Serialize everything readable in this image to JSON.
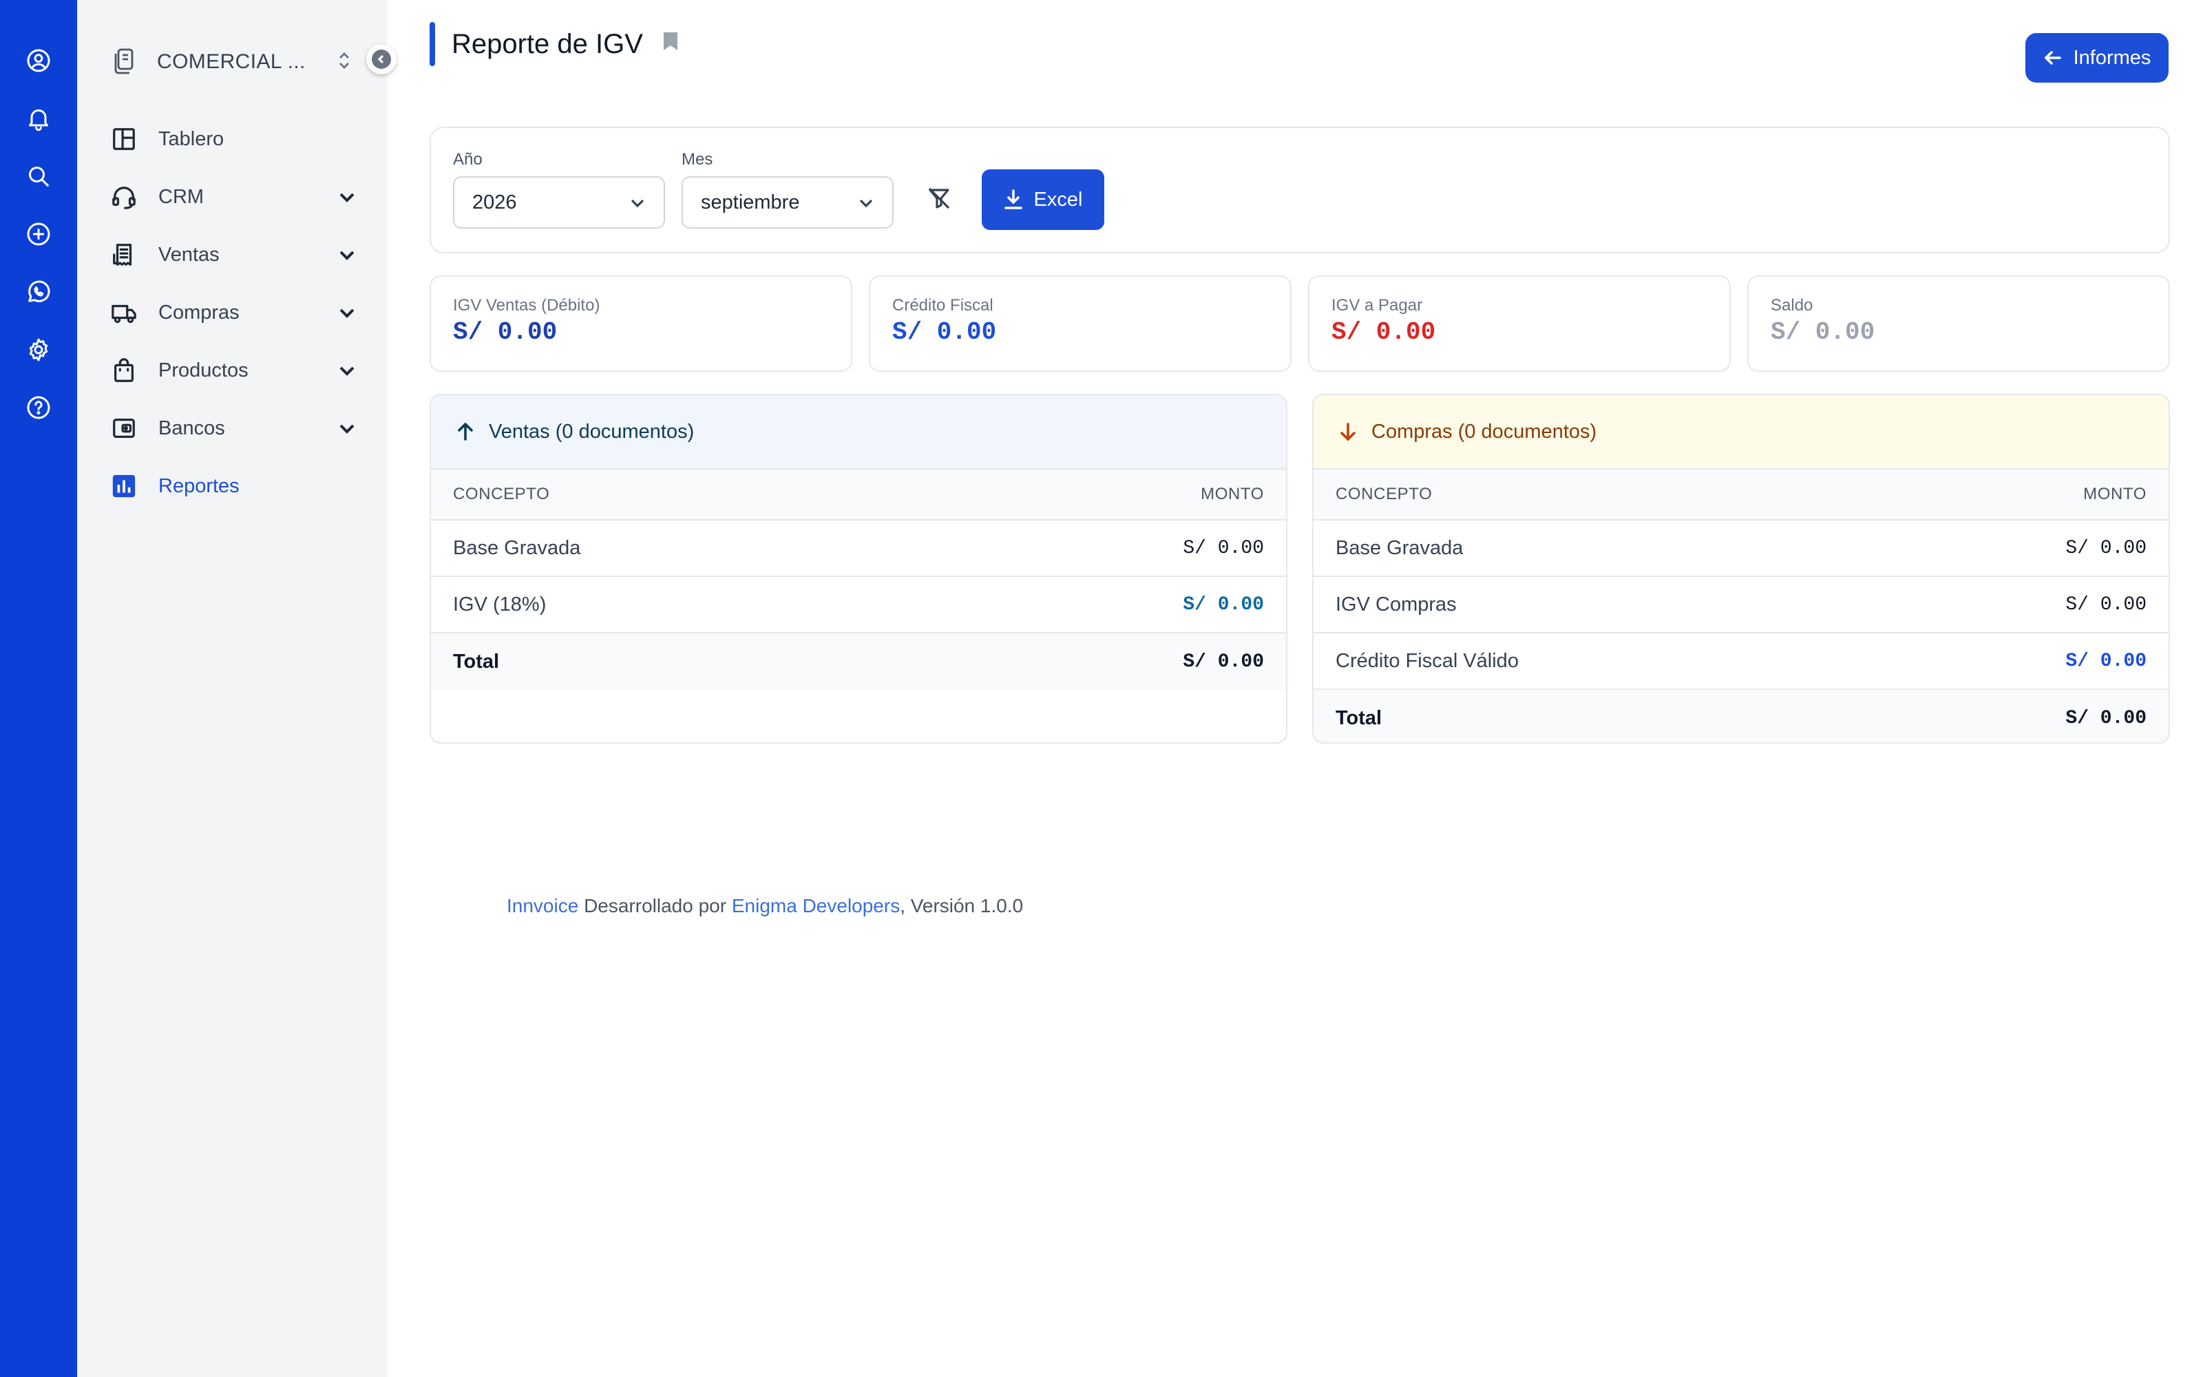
{
  "rail": {
    "icons": [
      "user-circle-icon",
      "bell-icon",
      "search-icon",
      "plus-circle-icon",
      "whatsapp-icon",
      "gear-icon",
      "help-circle-icon"
    ]
  },
  "sidebar": {
    "company": "COMERCIAL ...",
    "items": [
      {
        "label": "Tablero",
        "icon": "layout-icon",
        "expandable": false
      },
      {
        "label": "CRM",
        "icon": "headset-icon",
        "expandable": true
      },
      {
        "label": "Ventas",
        "icon": "receipt-icon",
        "expandable": true
      },
      {
        "label": "Compras",
        "icon": "truck-icon",
        "expandable": true
      },
      {
        "label": "Productos",
        "icon": "bag-icon",
        "expandable": true
      },
      {
        "label": "Bancos",
        "icon": "wallet-icon",
        "expandable": true
      },
      {
        "label": "Reportes",
        "icon": "chart-icon",
        "expandable": false,
        "active": true
      }
    ]
  },
  "header": {
    "title": "Reporte de IGV",
    "informes_label": "Informes"
  },
  "filters": {
    "year_label": "Año",
    "year_value": "2026",
    "month_label": "Mes",
    "month_value": "septiembre",
    "excel_label": "Excel"
  },
  "summary": [
    {
      "label": "IGV Ventas (Débito)",
      "value": "S/ 0.00",
      "color": "#1e40af"
    },
    {
      "label": "Crédito Fiscal",
      "value": "S/ 0.00",
      "color": "#1d4ed8"
    },
    {
      "label": "IGV a Pagar",
      "value": "S/ 0.00",
      "color": "#dc2626"
    },
    {
      "label": "Saldo",
      "value": "S/ 0.00",
      "color": "#9ca3af"
    }
  ],
  "ventas": {
    "title": "Ventas (0 documentos)",
    "col_concept": "CONCEPTO",
    "col_amount": "MONTO",
    "rows": [
      {
        "concept": "Base Gravada",
        "amount": "S/ 0.00"
      },
      {
        "concept": "IGV (18%)",
        "amount": "S/ 0.00"
      }
    ],
    "total_label": "Total",
    "total_amount": "S/ 0.00"
  },
  "compras": {
    "title": "Compras (0 documentos)",
    "col_concept": "CONCEPTO",
    "col_amount": "MONTO",
    "rows": [
      {
        "concept": "Base Gravada",
        "amount": "S/ 0.00"
      },
      {
        "concept": "IGV Compras",
        "amount": "S/ 0.00"
      },
      {
        "concept": "Crédito Fiscal Válido",
        "amount": "S/ 0.00"
      }
    ],
    "total_label": "Total",
    "total_amount": "S/ 0.00"
  },
  "footer": {
    "brand": "Innvoice",
    "developed_by": " Desarrollado por ",
    "company": "Enigma Developers",
    "version": ", Versión 1.0.0"
  },
  "colors": {
    "primary": "#1d4ed8",
    "rail": "#0b3fd6",
    "ventas_head_bg": "#f0f6fb",
    "ventas_head_text": "#0f3a57",
    "compras_head_bg": "#fefce8",
    "compras_head_text": "#8a3a06"
  }
}
